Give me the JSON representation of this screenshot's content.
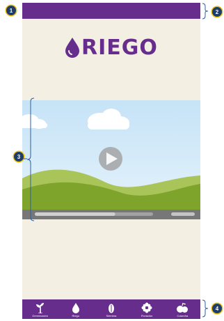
{
  "app": {
    "logo_text": "RIEGO",
    "brand_color": "#662d8c",
    "background_color": "#f4efe3"
  },
  "video_player": {
    "play_icon": "play-icon",
    "progress": 0.68
  },
  "bottom_nav": {
    "items": [
      {
        "label": "Germinación",
        "icon": "sprout-icon"
      },
      {
        "label": "Riego",
        "icon": "water-drop-icon"
      },
      {
        "label": "Siembra",
        "icon": "seed-icon"
      },
      {
        "label": "Floración",
        "icon": "flower-icon"
      },
      {
        "label": "Cosecha",
        "icon": "fruit-icon"
      }
    ]
  },
  "annotations": {
    "markers": [
      "1",
      "2",
      "3",
      "4"
    ],
    "marker_color": "#1d3d6b",
    "marker_ring_color": "#f0c20f"
  }
}
